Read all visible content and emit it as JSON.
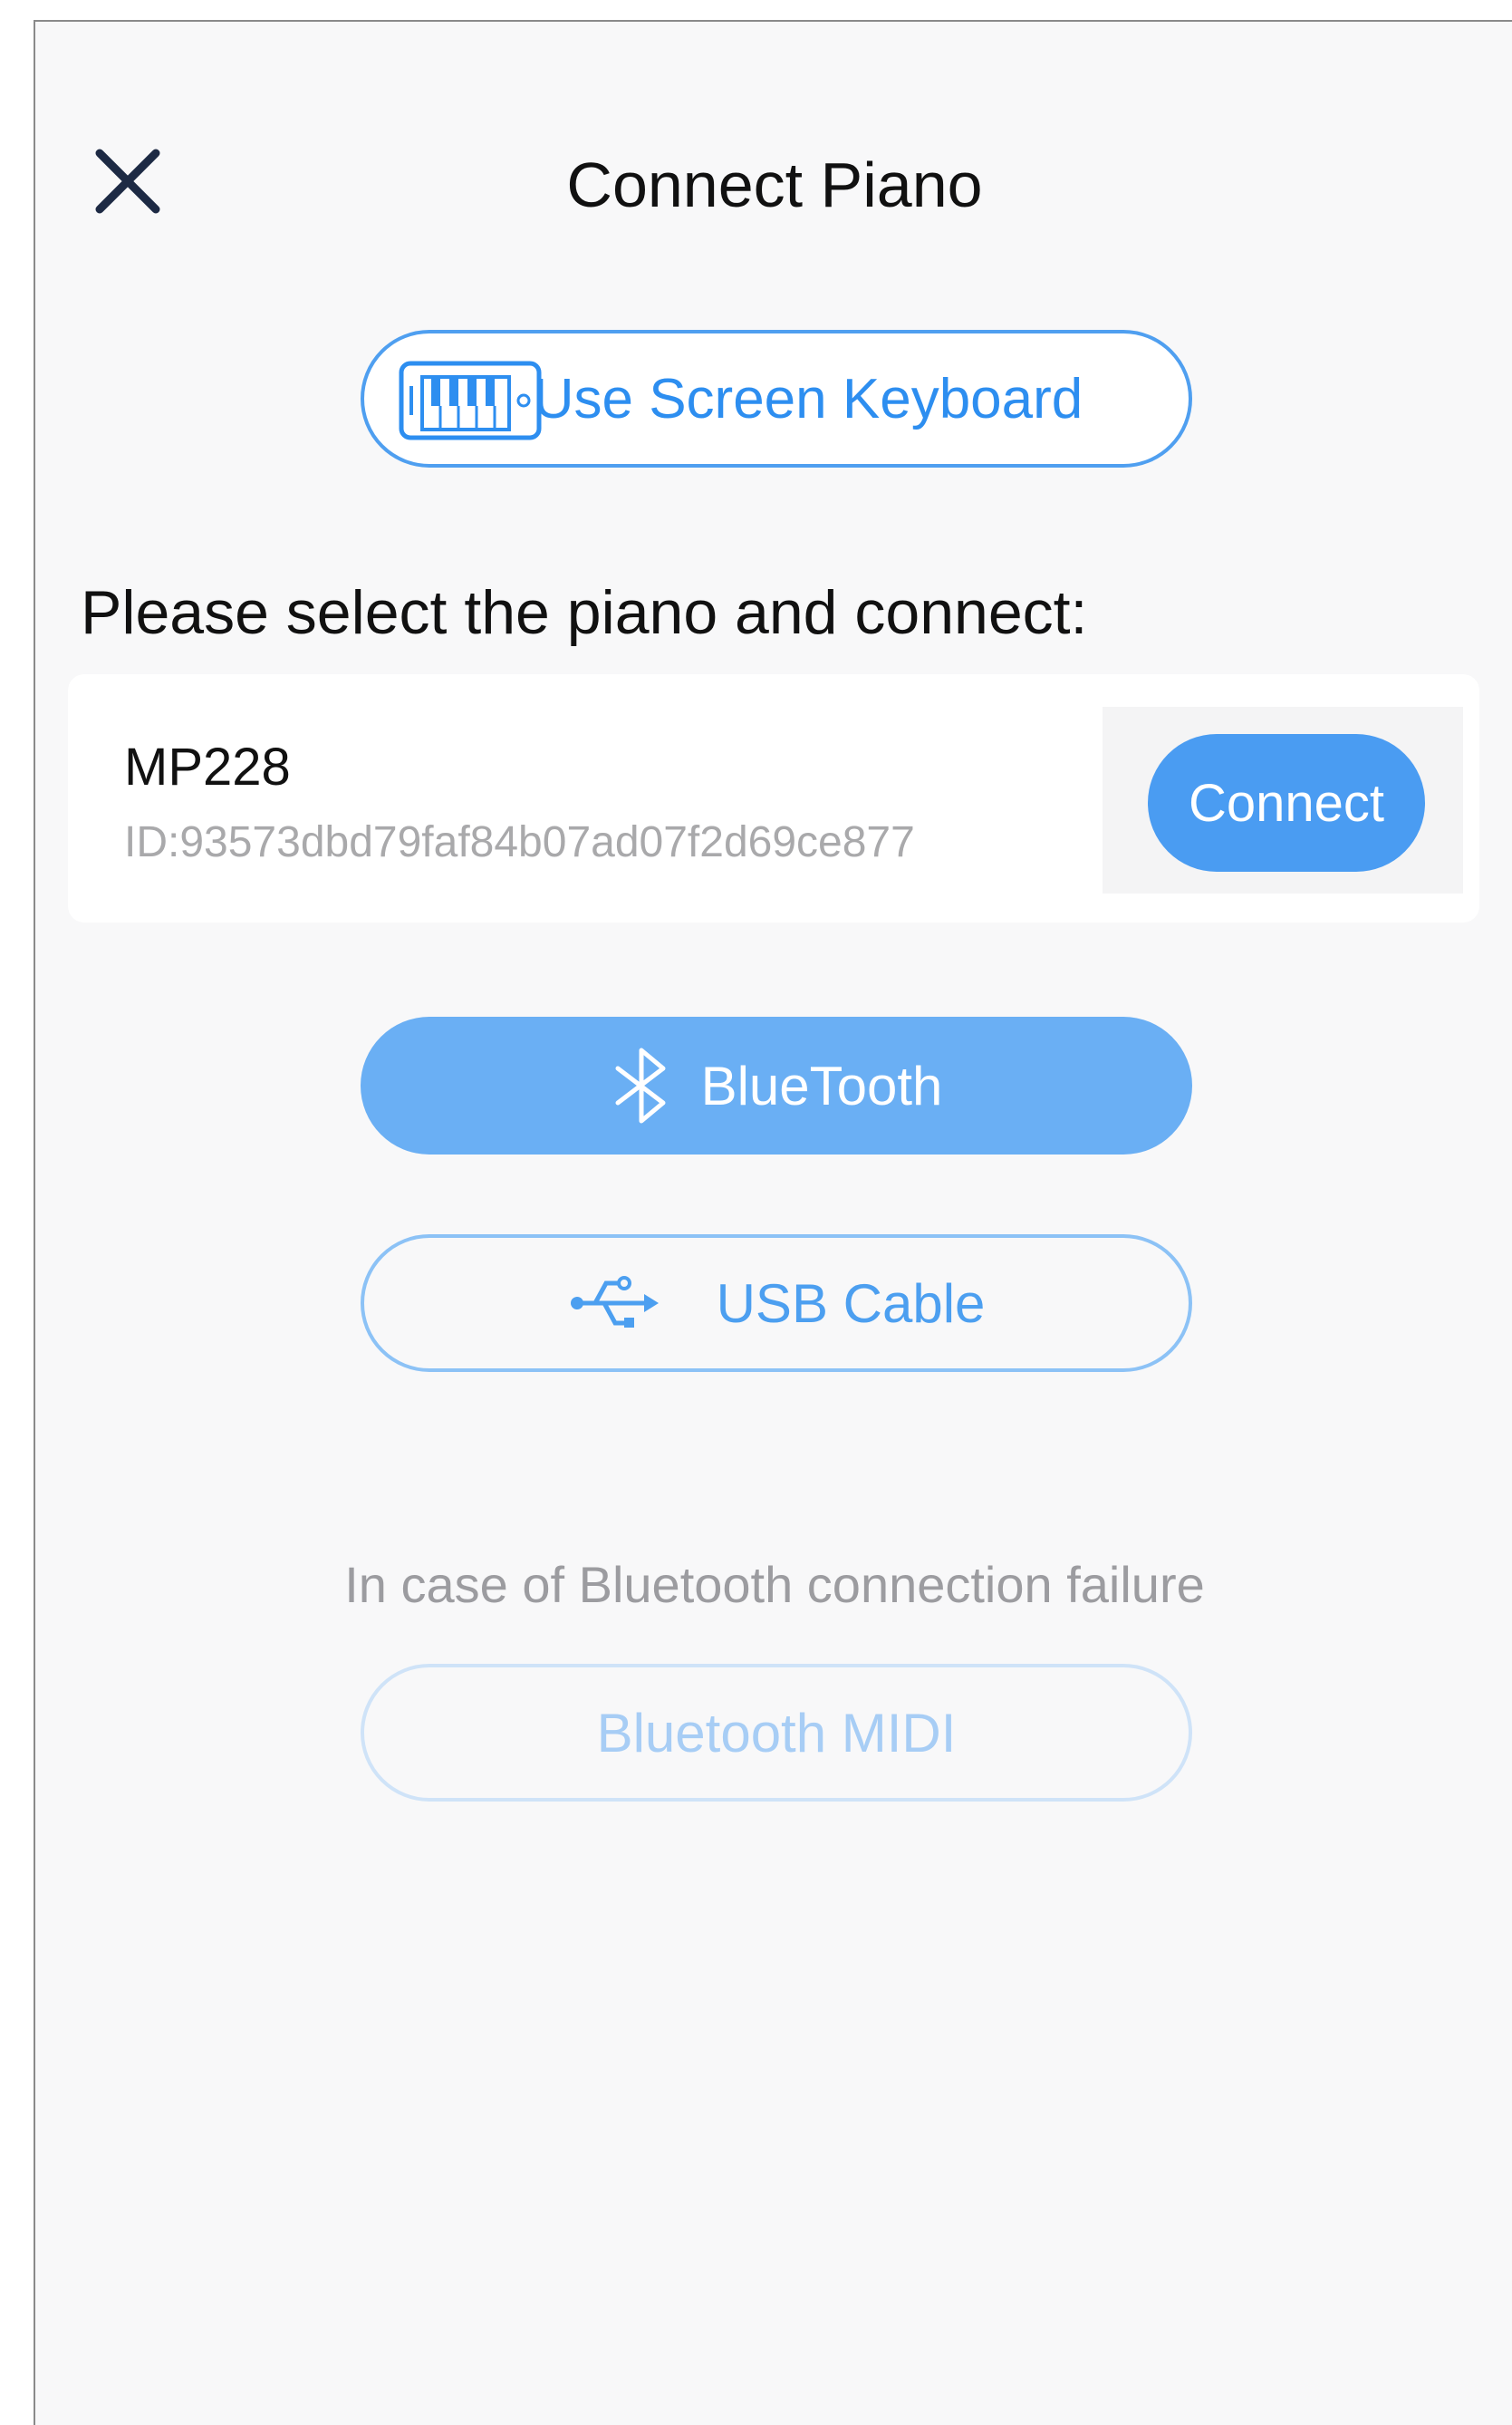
{
  "header": {
    "title": "Connect Piano",
    "close_icon": "close-icon"
  },
  "screen_keyboard": {
    "label": "Use Screen Keyboard",
    "icon": "piano-keyboard-icon"
  },
  "prompt": "Please select the piano and connect:",
  "devices": [
    {
      "name": "MP228",
      "id": "ID:93573dbd79faf84b07ad07f2d69ce877",
      "connect_label": "Connect"
    }
  ],
  "connection_modes": {
    "bluetooth": {
      "label": "BlueTooth",
      "icon": "bluetooth-icon",
      "selected": true
    },
    "usb": {
      "label": "USB Cable",
      "icon": "usb-icon",
      "selected": false
    }
  },
  "fallback": {
    "note": "In case of Bluetooth connection failure",
    "midi_label": "Bluetooth MIDI"
  },
  "colors": {
    "accent": "#4a9cf2",
    "selected_fill": "#6aaff4",
    "background": "#f8f8f9",
    "muted_text": "#a9a9ab"
  }
}
